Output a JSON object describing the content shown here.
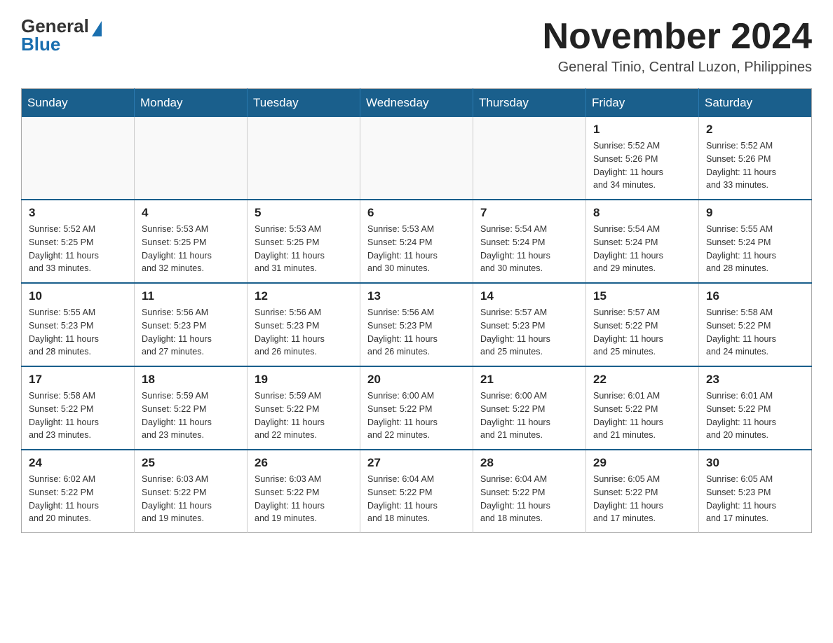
{
  "header": {
    "logo_general": "General",
    "logo_blue": "Blue",
    "month_title": "November 2024",
    "location": "General Tinio, Central Luzon, Philippines"
  },
  "weekdays": [
    "Sunday",
    "Monday",
    "Tuesday",
    "Wednesday",
    "Thursday",
    "Friday",
    "Saturday"
  ],
  "weeks": [
    [
      {
        "day": "",
        "info": ""
      },
      {
        "day": "",
        "info": ""
      },
      {
        "day": "",
        "info": ""
      },
      {
        "day": "",
        "info": ""
      },
      {
        "day": "",
        "info": ""
      },
      {
        "day": "1",
        "info": "Sunrise: 5:52 AM\nSunset: 5:26 PM\nDaylight: 11 hours\nand 34 minutes."
      },
      {
        "day": "2",
        "info": "Sunrise: 5:52 AM\nSunset: 5:26 PM\nDaylight: 11 hours\nand 33 minutes."
      }
    ],
    [
      {
        "day": "3",
        "info": "Sunrise: 5:52 AM\nSunset: 5:25 PM\nDaylight: 11 hours\nand 33 minutes."
      },
      {
        "day": "4",
        "info": "Sunrise: 5:53 AM\nSunset: 5:25 PM\nDaylight: 11 hours\nand 32 minutes."
      },
      {
        "day": "5",
        "info": "Sunrise: 5:53 AM\nSunset: 5:25 PM\nDaylight: 11 hours\nand 31 minutes."
      },
      {
        "day": "6",
        "info": "Sunrise: 5:53 AM\nSunset: 5:24 PM\nDaylight: 11 hours\nand 30 minutes."
      },
      {
        "day": "7",
        "info": "Sunrise: 5:54 AM\nSunset: 5:24 PM\nDaylight: 11 hours\nand 30 minutes."
      },
      {
        "day": "8",
        "info": "Sunrise: 5:54 AM\nSunset: 5:24 PM\nDaylight: 11 hours\nand 29 minutes."
      },
      {
        "day": "9",
        "info": "Sunrise: 5:55 AM\nSunset: 5:24 PM\nDaylight: 11 hours\nand 28 minutes."
      }
    ],
    [
      {
        "day": "10",
        "info": "Sunrise: 5:55 AM\nSunset: 5:23 PM\nDaylight: 11 hours\nand 28 minutes."
      },
      {
        "day": "11",
        "info": "Sunrise: 5:56 AM\nSunset: 5:23 PM\nDaylight: 11 hours\nand 27 minutes."
      },
      {
        "day": "12",
        "info": "Sunrise: 5:56 AM\nSunset: 5:23 PM\nDaylight: 11 hours\nand 26 minutes."
      },
      {
        "day": "13",
        "info": "Sunrise: 5:56 AM\nSunset: 5:23 PM\nDaylight: 11 hours\nand 26 minutes."
      },
      {
        "day": "14",
        "info": "Sunrise: 5:57 AM\nSunset: 5:23 PM\nDaylight: 11 hours\nand 25 minutes."
      },
      {
        "day": "15",
        "info": "Sunrise: 5:57 AM\nSunset: 5:22 PM\nDaylight: 11 hours\nand 25 minutes."
      },
      {
        "day": "16",
        "info": "Sunrise: 5:58 AM\nSunset: 5:22 PM\nDaylight: 11 hours\nand 24 minutes."
      }
    ],
    [
      {
        "day": "17",
        "info": "Sunrise: 5:58 AM\nSunset: 5:22 PM\nDaylight: 11 hours\nand 23 minutes."
      },
      {
        "day": "18",
        "info": "Sunrise: 5:59 AM\nSunset: 5:22 PM\nDaylight: 11 hours\nand 23 minutes."
      },
      {
        "day": "19",
        "info": "Sunrise: 5:59 AM\nSunset: 5:22 PM\nDaylight: 11 hours\nand 22 minutes."
      },
      {
        "day": "20",
        "info": "Sunrise: 6:00 AM\nSunset: 5:22 PM\nDaylight: 11 hours\nand 22 minutes."
      },
      {
        "day": "21",
        "info": "Sunrise: 6:00 AM\nSunset: 5:22 PM\nDaylight: 11 hours\nand 21 minutes."
      },
      {
        "day": "22",
        "info": "Sunrise: 6:01 AM\nSunset: 5:22 PM\nDaylight: 11 hours\nand 21 minutes."
      },
      {
        "day": "23",
        "info": "Sunrise: 6:01 AM\nSunset: 5:22 PM\nDaylight: 11 hours\nand 20 minutes."
      }
    ],
    [
      {
        "day": "24",
        "info": "Sunrise: 6:02 AM\nSunset: 5:22 PM\nDaylight: 11 hours\nand 20 minutes."
      },
      {
        "day": "25",
        "info": "Sunrise: 6:03 AM\nSunset: 5:22 PM\nDaylight: 11 hours\nand 19 minutes."
      },
      {
        "day": "26",
        "info": "Sunrise: 6:03 AM\nSunset: 5:22 PM\nDaylight: 11 hours\nand 19 minutes."
      },
      {
        "day": "27",
        "info": "Sunrise: 6:04 AM\nSunset: 5:22 PM\nDaylight: 11 hours\nand 18 minutes."
      },
      {
        "day": "28",
        "info": "Sunrise: 6:04 AM\nSunset: 5:22 PM\nDaylight: 11 hours\nand 18 minutes."
      },
      {
        "day": "29",
        "info": "Sunrise: 6:05 AM\nSunset: 5:22 PM\nDaylight: 11 hours\nand 17 minutes."
      },
      {
        "day": "30",
        "info": "Sunrise: 6:05 AM\nSunset: 5:23 PM\nDaylight: 11 hours\nand 17 minutes."
      }
    ]
  ]
}
